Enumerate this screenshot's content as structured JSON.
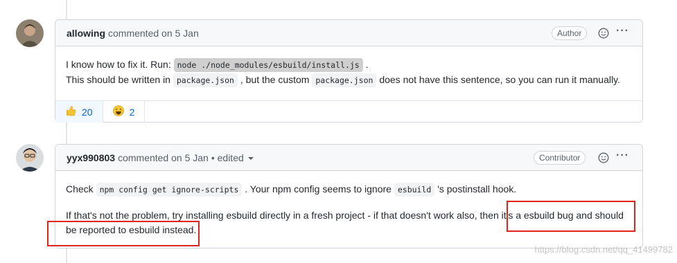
{
  "comments": [
    {
      "author": "allowing",
      "meta": "commented on 5 Jan",
      "badge": "Author",
      "line1_pre": "I know how to fix it. Run: ",
      "line1_code": "node ./node_modules/esbuild/install.js",
      "line1_post": " .",
      "line2_pre": "This should be written in ",
      "line2_code1": "package.json",
      "line2_mid": " , but the custom ",
      "line2_code2": "package.json",
      "line2_post": " does not have this sentence, so you can run it manually.",
      "reactions": [
        {
          "icon": "thumbs-up-icon",
          "count": "20"
        },
        {
          "icon": "laugh-icon",
          "count": "2"
        }
      ]
    },
    {
      "author": "yyx990803",
      "meta": "commented on 5 Jan",
      "edited": "• edited",
      "badge": "Contributor",
      "p1_pre": "Check ",
      "p1_code1": "npm config get ignore-scripts",
      "p1_mid": " . Your npm config seems to ignore ",
      "p1_code2": "esbuild",
      "p1_post": " 's postinstall hook.",
      "p2_a": "If that's not the problem, try installing esbuild directly in a fresh project - if that doesn't work also, then ",
      "p2_b": "it's a esbuild bug and should",
      "p2_c": "be reported to esbuild instead."
    }
  ],
  "watermark": "https://blog.csdn.net/qq_41499782",
  "colors": {
    "highlight": "#e0241b",
    "link": "#0366d6"
  }
}
